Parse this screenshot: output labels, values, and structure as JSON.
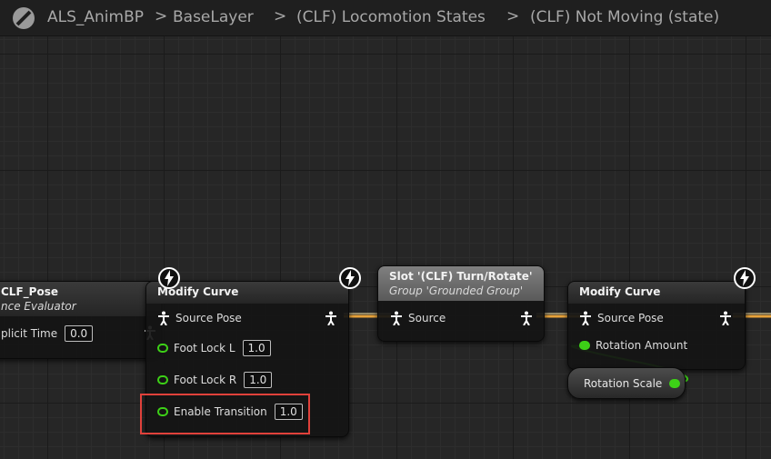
{
  "breadcrumb": {
    "items": [
      "ALS_AnimBP",
      "BaseLayer",
      "(CLF) Locomotion States",
      "(CLF) Not Moving (state)"
    ],
    "separator": ">"
  },
  "nodes": {
    "curve_node": {
      "title": "CLF_Pose",
      "subtitle": "nce Evaluator",
      "pin_label": "plicit Time",
      "pin_value": "0.0"
    },
    "modify_curve_1": {
      "title": "Modify Curve",
      "source_pose": "Source Pose",
      "foot_lock_l_label": "Foot Lock L",
      "foot_lock_l_value": "1.0",
      "foot_lock_r_label": "Foot Lock R",
      "foot_lock_r_value": "1.0",
      "enable_transition_label": "Enable Transition",
      "enable_transition_value": "1.0"
    },
    "slot_node": {
      "title": "Slot '(CLF) Turn/Rotate'",
      "subtitle": "Group 'Grounded Group'",
      "source": "Source"
    },
    "modify_curve_2": {
      "title": "Modify Curve",
      "source_pose": "Source Pose",
      "rotation_amount": "Rotation Amount"
    },
    "rotation_scale": {
      "label": "Rotation Scale"
    }
  },
  "colors": {
    "exec_wire": "#e8a33a",
    "bool_pin": "#3dd017",
    "highlight": "#e0413b"
  },
  "icons": [
    "blueprint-logo-icon",
    "pose-icon",
    "bolt-icon",
    "bool-pin-icon"
  ]
}
